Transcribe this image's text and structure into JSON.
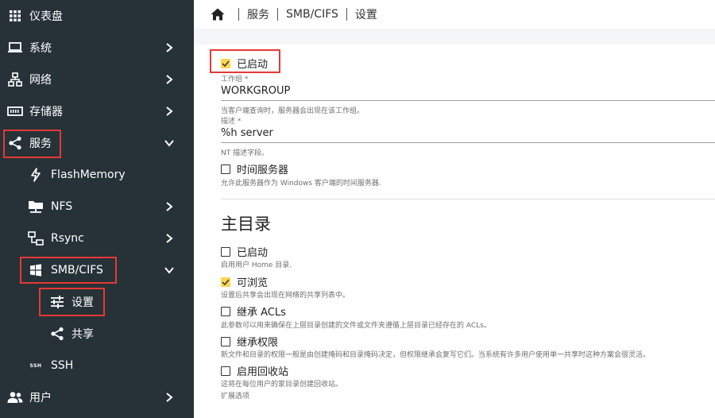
{
  "sidebar": {
    "items": [
      {
        "label": "仪表盘",
        "icon": "dashboard-grid-icon"
      },
      {
        "label": "系统",
        "icon": "laptop-icon"
      },
      {
        "label": "网络",
        "icon": "network-icon"
      },
      {
        "label": "存储器",
        "icon": "storage-icon"
      },
      {
        "label": "服务",
        "icon": "share-icon"
      },
      {
        "label": "FlashMemory",
        "icon": "flash-icon"
      },
      {
        "label": "NFS",
        "icon": "nfs-folder-icon"
      },
      {
        "label": "Rsync",
        "icon": "rsync-icon"
      },
      {
        "label": "SMB/CIFS",
        "icon": "windows-icon"
      },
      {
        "label": "设置",
        "icon": "tune-icon"
      },
      {
        "label": "共享",
        "icon": "share-icon"
      },
      {
        "label": "SSH",
        "icon": "ssh-icon",
        "icon_text": "SSH"
      },
      {
        "label": "用户",
        "icon": "users-icon"
      }
    ]
  },
  "breadcrumb": {
    "items": [
      "服务",
      "SMB/CIFS",
      "设置"
    ]
  },
  "form": {
    "enabled": {
      "label": "已启动",
      "checked": true
    },
    "workgroup": {
      "label": "工作组 *",
      "value": "WORKGROUP",
      "hint": "当客户端查询时，服务器会出现在该工作组。"
    },
    "description": {
      "label": "描述 *",
      "value": "%h server",
      "hint": "NT 描述字段。"
    },
    "time_server": {
      "label": "时间服务器",
      "checked": false,
      "hint": "允许此服务器作为 Windows 客户端的时间服务器."
    }
  },
  "home": {
    "title": "主目录",
    "enabled": {
      "label": "已启动",
      "checked": false,
      "hint": "启用用户 Home 目录."
    },
    "browseable": {
      "label": "可浏览",
      "checked": true,
      "hint": "设置后共享会出现在网络的共享列表中。"
    },
    "inherit_acls": {
      "label": "继承 ACLs",
      "checked": false,
      "hint": "此参数可以用来确保在上层目录创建的文件或文件夹遵循上层目录已经存在的 ACLs。"
    },
    "inherit_perms": {
      "label": "继承权限",
      "checked": false,
      "hint": "新文件和目录的权限一般是由创建掩码和目录掩码决定，但权限继承会复写它们。当系统有许多用户使用单一共享时这种方案会很灵活。"
    },
    "recycle_bin": {
      "label": "启用回收站",
      "checked": false,
      "hint": "这将在每位用户的家目录创建回收站。"
    },
    "extra_options": "扩展选项"
  }
}
